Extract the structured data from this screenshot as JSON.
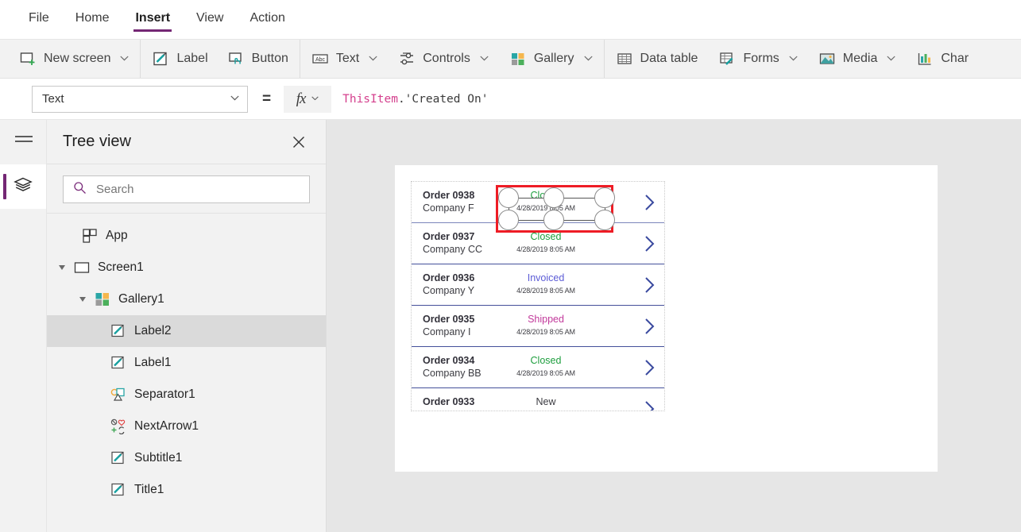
{
  "menu": {
    "items": [
      {
        "label": "File",
        "active": false
      },
      {
        "label": "Home",
        "active": false
      },
      {
        "label": "Insert",
        "active": true
      },
      {
        "label": "View",
        "active": false
      },
      {
        "label": "Action",
        "active": false
      }
    ]
  },
  "ribbon": {
    "groups": [
      {
        "items": [
          {
            "label": "New screen",
            "icon": "new-screen-icon",
            "caret": true
          }
        ]
      },
      {
        "items": [
          {
            "label": "Label",
            "icon": "label-icon",
            "caret": false
          },
          {
            "label": "Button",
            "icon": "button-icon",
            "caret": false
          }
        ]
      },
      {
        "items": [
          {
            "label": "Text",
            "icon": "text-abc-icon",
            "caret": true
          },
          {
            "label": "Controls",
            "icon": "controls-sliders-icon",
            "caret": true
          },
          {
            "label": "Gallery",
            "icon": "gallery-icon",
            "caret": true
          }
        ]
      },
      {
        "items": [
          {
            "label": "Data table",
            "icon": "data-table-icon",
            "caret": false
          },
          {
            "label": "Forms",
            "icon": "forms-icon",
            "caret": true
          },
          {
            "label": "Media",
            "icon": "media-image-icon",
            "caret": true
          },
          {
            "label": "Char",
            "icon": "charts-bar-icon",
            "caret": false
          }
        ]
      }
    ]
  },
  "formula": {
    "property": "Text",
    "equals": "=",
    "fx_label": "fx",
    "expression_object": "ThisItem",
    "expression_property": ".'Created On'"
  },
  "rail": {
    "hamburger": "hamburger-menu-icon",
    "tree_tab": "layers-icon"
  },
  "tree": {
    "title": "Tree view",
    "close": "×",
    "search_placeholder": "Search",
    "search_value": "",
    "items": [
      {
        "label": "App",
        "icon": "app-icon",
        "depth": 0,
        "expander": "none",
        "selected": false
      },
      {
        "label": "Screen1",
        "icon": "screen-icon",
        "depth": 0,
        "expander": "expanded",
        "selected": false
      },
      {
        "label": "Gallery1",
        "icon": "gallery-icon",
        "depth": 1,
        "expander": "expanded",
        "selected": false
      },
      {
        "label": "Label2",
        "icon": "label-icon",
        "depth": 2,
        "expander": "none",
        "selected": true
      },
      {
        "label": "Label1",
        "icon": "label-icon",
        "depth": 2,
        "expander": "none",
        "selected": false
      },
      {
        "label": "Separator1",
        "icon": "separator-icon",
        "depth": 2,
        "expander": "none",
        "selected": false
      },
      {
        "label": "NextArrow1",
        "icon": "next-arrow-icon",
        "depth": 2,
        "expander": "none",
        "selected": false
      },
      {
        "label": "Subtitle1",
        "icon": "label-icon",
        "depth": 2,
        "expander": "none",
        "selected": false
      },
      {
        "label": "Title1",
        "icon": "label-icon",
        "depth": 2,
        "expander": "none",
        "selected": false
      }
    ]
  },
  "canvas": {
    "gallery": {
      "rows": [
        {
          "title": "Order 0938",
          "subtitle": "Company F",
          "status": "Closed",
          "status_color": "#1e9e3e",
          "date": "4/28/2019 8:05 AM",
          "chevron": "chevron-right-icon",
          "selected_label": true
        },
        {
          "title": "Order 0937",
          "subtitle": "Company CC",
          "status": "Closed",
          "status_color": "#1e9e3e",
          "date": "4/28/2019 8:05 AM",
          "chevron": "chevron-right-icon",
          "selected_label": false
        },
        {
          "title": "Order 0936",
          "subtitle": "Company Y",
          "status": "Invoiced",
          "status_color": "#5b5bd6",
          "date": "4/28/2019 8:05 AM",
          "chevron": "chevron-right-icon",
          "selected_label": false
        },
        {
          "title": "Order 0935",
          "subtitle": "Company I",
          "status": "Shipped",
          "status_color": "#c2399b",
          "date": "4/28/2019 8:05 AM",
          "chevron": "chevron-right-icon",
          "selected_label": false
        },
        {
          "title": "Order 0934",
          "subtitle": "Company BB",
          "status": "Closed",
          "status_color": "#1e9e3e",
          "date": "4/28/2019 8:05 AM",
          "chevron": "chevron-right-icon",
          "selected_label": false
        },
        {
          "title": "Order 0933",
          "subtitle": "",
          "status": "New",
          "status_color": "#3b3b41",
          "date": "",
          "chevron": "chevron-right-icon",
          "selected_label": false
        }
      ]
    },
    "selection": {
      "name": "label2-selection",
      "border_color": "#ee1c25",
      "handle_count": 6
    }
  },
  "colors": {
    "accent_purple": "#742774",
    "chevron_blue": "#3a4a9f",
    "separator_blue": "#44509a",
    "selection_red": "#ee1c25"
  }
}
